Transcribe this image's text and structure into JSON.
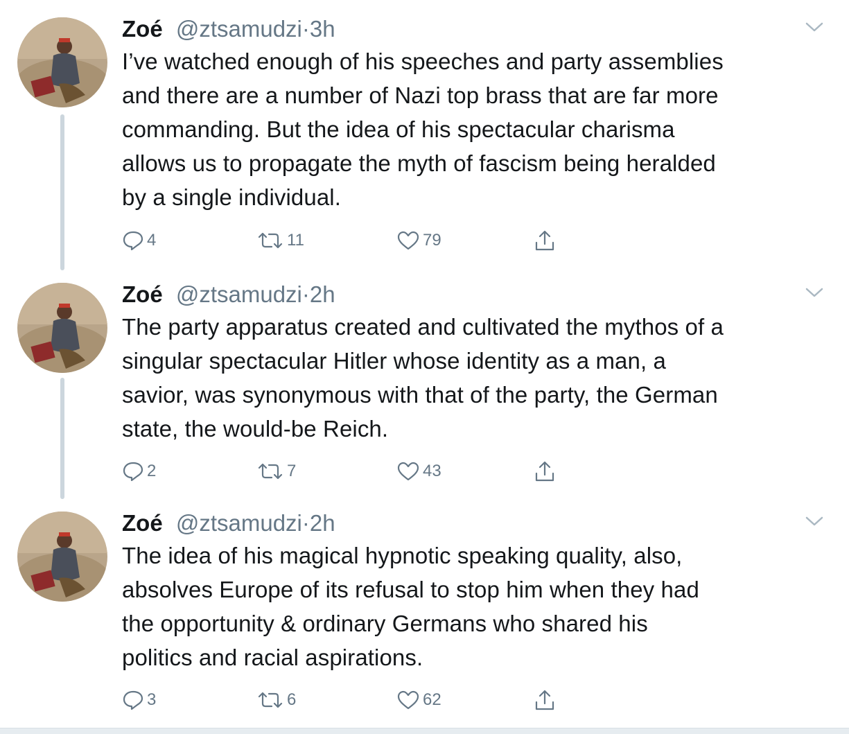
{
  "tweets": [
    {
      "name": "Zoé",
      "handle": "@ztsamudzi",
      "separator": "·",
      "time": "3h",
      "lines": [
        "I’ve watched enough of his speeches and party assemblies",
        "and there are a number of Nazi top brass that are far more",
        "commanding. But the idea of his spectacular charisma",
        "allows us to propagate the myth of fascism being heralded",
        "by a single individual."
      ],
      "replies": "4",
      "retweets": "11",
      "likes": "79"
    },
    {
      "name": "Zoé",
      "handle": "@ztsamudzi",
      "separator": "·",
      "time": "2h",
      "lines": [
        "The party apparatus created and cultivated the mythos of a",
        "singular spectacular Hitler whose identity as a man, a",
        "savior, was synonymous with that of the party, the German",
        "state, the would-be Reich."
      ],
      "replies": "2",
      "retweets": "7",
      "likes": "43"
    },
    {
      "name": "Zoé",
      "handle": "@ztsamudzi",
      "separator": "·",
      "time": "2h",
      "lines": [
        "The idea of his magical hypnotic speaking quality, also,",
        "absolves Europe of its refusal to stop him when they had",
        "the opportunity & ordinary Germans who shared his",
        "politics and racial aspirations."
      ],
      "replies": "3",
      "retweets": "6",
      "likes": "62"
    }
  ],
  "icons": {
    "reply": "reply-icon",
    "retweet": "retweet-icon",
    "like": "heart-icon",
    "share": "share-icon",
    "menu": "chevron-down-icon"
  },
  "colors": {
    "text": "#14171a",
    "secondary": "#657786",
    "thread_line": "#ccd6dd"
  }
}
